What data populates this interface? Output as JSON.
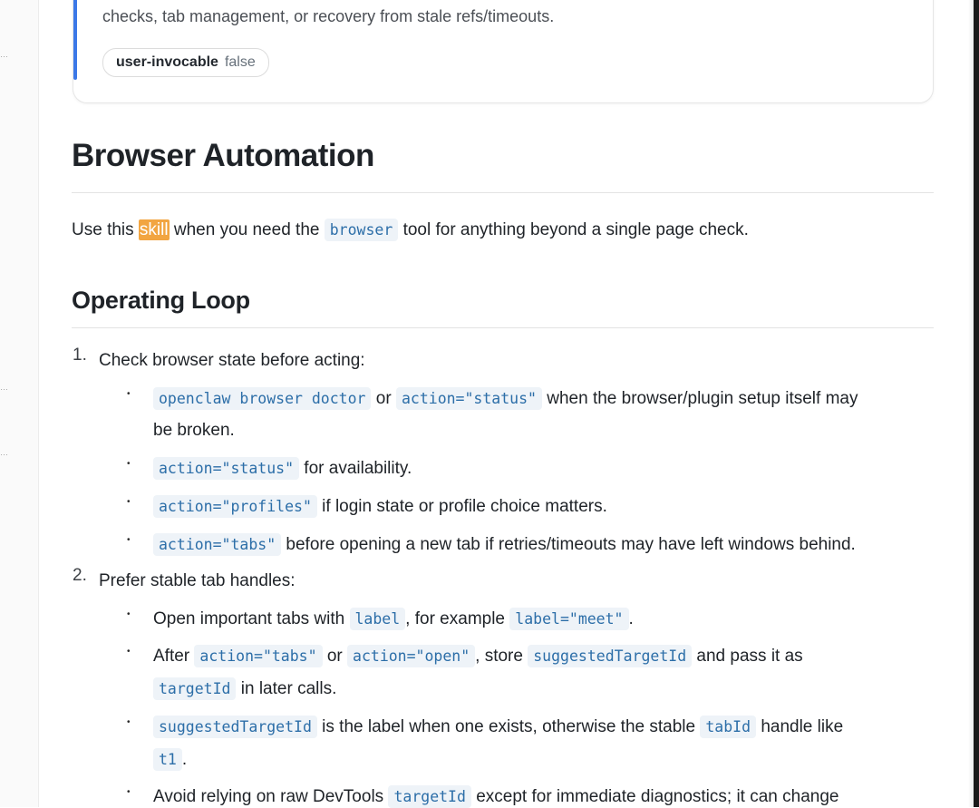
{
  "card": {
    "description": "checks, tab management, or recovery from stale refs/timeouts.",
    "badge": {
      "key": "user-invocable",
      "value": "false"
    }
  },
  "title": "Browser Automation",
  "intro": {
    "pre": "Use this",
    "highlight": "skill",
    "mid": "when you need the",
    "code": "browser",
    "post": "tool for anything beyond a single page check."
  },
  "section": {
    "title": "Operating Loop"
  },
  "steps": [
    {
      "number": "1.",
      "text": "Check browser state before acting:",
      "bullets": [
        {
          "c1": "openclaw browser doctor",
          "t1": "or",
          "c2": "action=\"status\"",
          "t2": "when the browser/plugin setup itself may",
          "t3": "be broken."
        },
        {
          "c1": "action=\"status\"",
          "t1": "for availability."
        },
        {
          "c1": "action=\"profiles\"",
          "t1": "if login state or profile choice matters."
        },
        {
          "c1": "action=\"tabs\"",
          "t1": "before opening a new tab if retries/timeouts may have left windows behind."
        }
      ]
    },
    {
      "number": "2.",
      "text": "Prefer stable tab handles:",
      "bullets": [
        {
          "t1": "Open important tabs with",
          "c1": "label",
          "t2": ", for example",
          "c2": "label=\"meet\"",
          "t3": "."
        },
        {
          "t1": "After",
          "c1": "action=\"tabs\"",
          "t2": "or",
          "c2": "action=\"open\"",
          "t3": ", store",
          "c3": "suggestedTargetId",
          "t4": "and pass it as",
          "c4": "targetId",
          "t5": "in later calls."
        },
        {
          "c1": "suggestedTargetId",
          "t1": "is the label when one exists, otherwise the stable",
          "c2": "tabId",
          "t2": "handle like",
          "c3": "t1",
          "t3": "."
        },
        {
          "t1": "Avoid relying on raw DevTools",
          "c1": "targetId",
          "t2": "except for immediate diagnostics; it can change"
        }
      ]
    }
  ]
}
